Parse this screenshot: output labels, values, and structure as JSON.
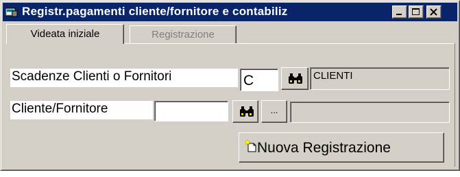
{
  "window": {
    "title": "Registr.pagamenti cliente/fornitore e contabiliz",
    "colors": {
      "titlebar": "#0a246a",
      "face": "#d4d0c8",
      "title_text": "#ffffff"
    }
  },
  "title_buttons": [
    "minimize-icon",
    "maximize-icon",
    "close-icon"
  ],
  "tabs": [
    {
      "label": "Videata iniziale",
      "state": "active"
    },
    {
      "label": "Registrazione",
      "state": "disabled"
    }
  ],
  "form": {
    "scadenze_label": "Scadenze Clienti o Fornitori",
    "scadenze_code": "C",
    "scadenze_desc": "CLIENTI",
    "cliente_label": "Cliente/Fornitore",
    "cliente_code": "",
    "cliente_desc": "",
    "lookup_icon": "binoculars-icon",
    "browse_label": "..."
  },
  "actions": {
    "new_registration_label": "Nuova Registrazione",
    "new_registration_icon": "new-document-icon"
  }
}
